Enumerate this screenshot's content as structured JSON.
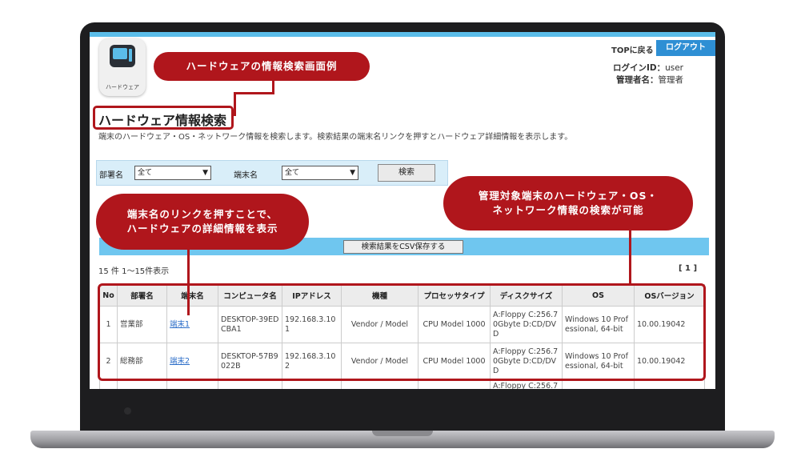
{
  "app_icon": {
    "label": "ハードウェア"
  },
  "callouts": {
    "header": "ハードウェアの情報検索画面例",
    "link_line1": "端末名のリンクを押すことで、",
    "link_line2": "ハードウェアの詳細情報を表示",
    "search_line1": "管理対象端末のハードウェア・OS・",
    "search_line2": "ネットワーク情報の検索が可能"
  },
  "header": {
    "top_link": "TOPに戻る",
    "logout": "ログアウト",
    "login_id_label": "ログインID：",
    "login_id": "user",
    "admin_label": "管理者名：",
    "admin_name": "管理者"
  },
  "page": {
    "title": "ハードウェア情報検索",
    "description": "端末のハードウェア・OS・ネットワーク情報を検索します。検索結果の端末名リンクを押すとハードウェア詳細情報を表示します。"
  },
  "search": {
    "dept_label": "部署名",
    "dept_value": "全て",
    "terminal_label": "端末名",
    "terminal_value": "全て",
    "search_button": "検索"
  },
  "csv_button": "検索結果をCSV保存する",
  "result_count": "15 件 1～15件表示",
  "pager": "[ 1 ]",
  "table": {
    "headers": [
      "No",
      "部署名",
      "端末名",
      "コンピュータ名",
      "IPアドレス",
      "機種",
      "プロセッサタイプ",
      "ディスクサイズ",
      "OS",
      "OSバージョン"
    ],
    "rows": [
      {
        "no": "1",
        "dept": "営業部",
        "terminal": "端末1",
        "computer": "DESKTOP-39EDCBA1",
        "ip": "192.168.3.101",
        "model": "Vendor / Model",
        "cpu": "CPU Model 1000",
        "disk": "A:Floppy C:256.70Gbyte D:CD/DVD",
        "os": "Windows 10 Professional, 64-bit",
        "os_version": "10.00.19042"
      },
      {
        "no": "2",
        "dept": "総務部",
        "terminal": "端末2",
        "computer": "DESKTOP-57B9022B",
        "ip": "192.168.3.102",
        "model": "Vendor / Model",
        "cpu": "CPU Model 1000",
        "disk": "A:Floppy C:256.70Gbyte D:CD/DVD",
        "os": "Windows 10 Professional, 64-bit",
        "os_version": "10.00.19042"
      }
    ],
    "partial_row_disk": "A:Floppy C:256.7"
  }
}
